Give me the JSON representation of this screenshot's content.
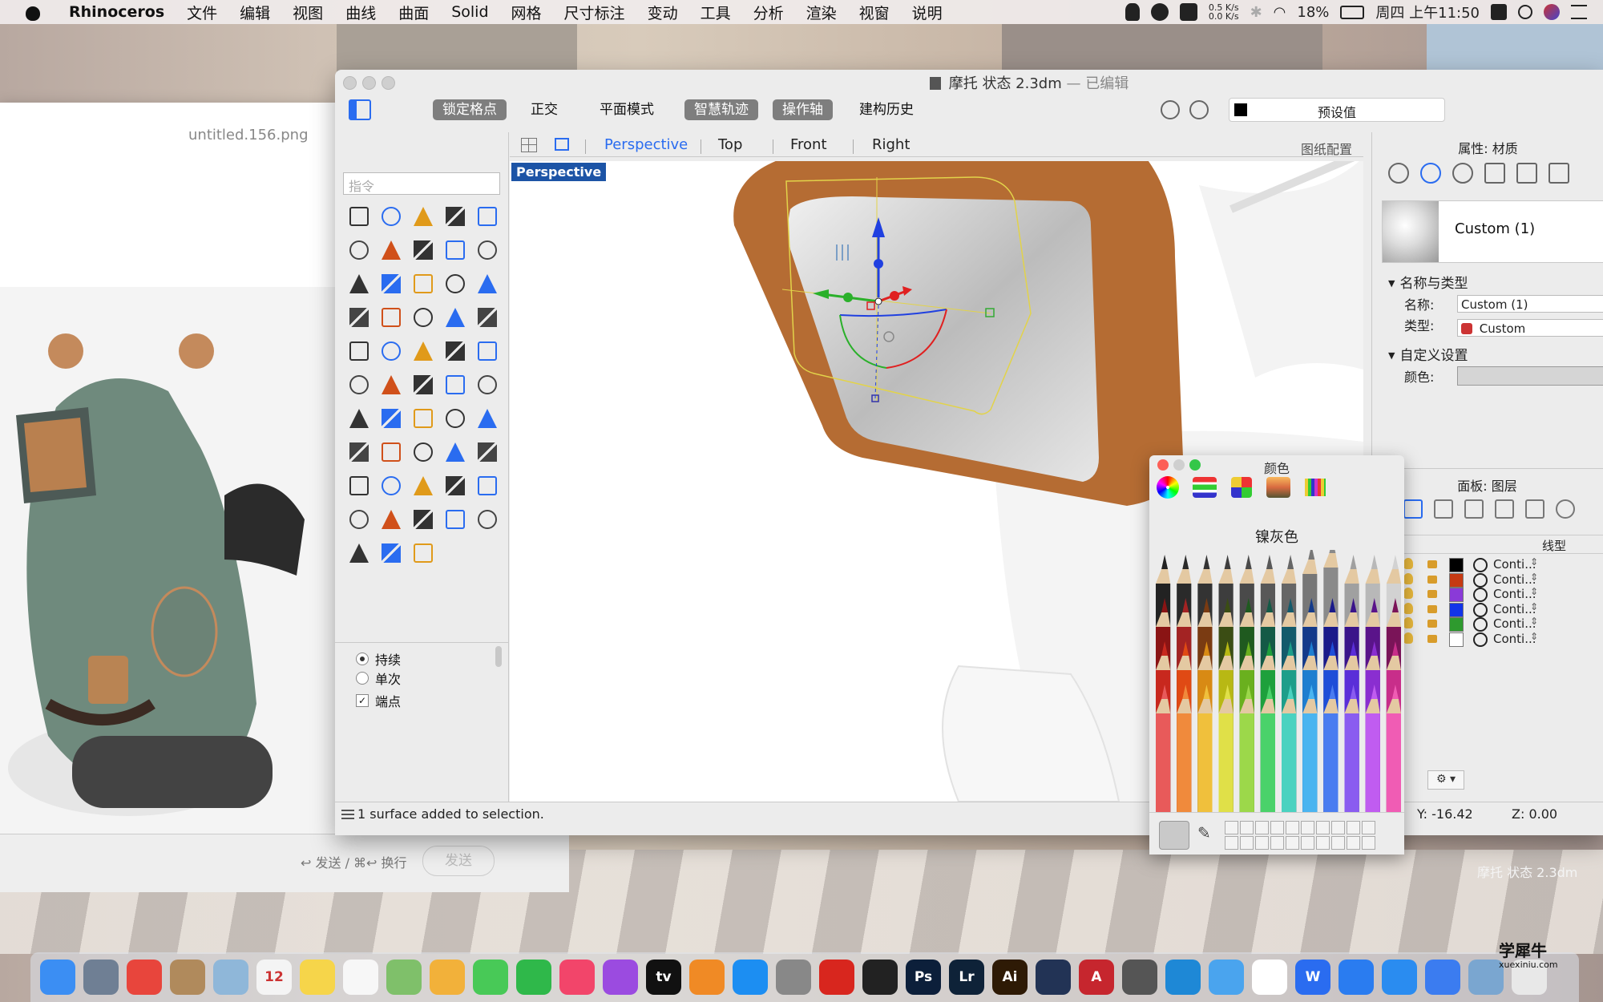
{
  "menubar": {
    "app_name": "Rhinoceros",
    "items": [
      "文件",
      "编辑",
      "视图",
      "曲线",
      "曲面",
      "Solid",
      "网格",
      "尺寸标注",
      "变动",
      "工具",
      "分析",
      "渲染",
      "视窗",
      "说明"
    ],
    "net_up": "0.5 K/s",
    "net_down": "0.0 K/s",
    "battery": "18%",
    "clock": "周四 上午11:50"
  },
  "preview_window": {
    "filename": "untitled.156.png"
  },
  "chat_window": {
    "hint": "↩ 发送 / ⌘↩ 换行",
    "send_label": "发送"
  },
  "rhino_window": {
    "title": "摩托 状态 2.3dm",
    "title_status": "— 已编辑",
    "toolbar": {
      "buttons": [
        {
          "label": "锁定格点",
          "on": true
        },
        {
          "label": "正交",
          "on": false
        },
        {
          "label": "平面模式",
          "on": false
        },
        {
          "label": "智慧轨迹",
          "on": true
        },
        {
          "label": "操作轴",
          "on": true
        },
        {
          "label": "建构历史",
          "on": false
        }
      ],
      "preset_label": "预设值",
      "preset_color": "#000000"
    },
    "command_placeholder": "指令",
    "command_options": {
      "persist_label": "持续",
      "once_label": "单次",
      "endpoint_label": "端点",
      "persist_selected": true,
      "endpoint_checked": true
    },
    "viewport_tabs": [
      "Perspective",
      "Top",
      "Front",
      "Right"
    ],
    "active_viewport": "Perspective",
    "layout_config_label": "图纸配置",
    "viewport_label": "Perspective",
    "status_text": "1 surface added to selection.",
    "coords": {
      "y": "Y: -16.42",
      "z": "Z: 0.00"
    }
  },
  "properties_panel": {
    "title": "属性: 材质",
    "material_name": "Custom (1)",
    "section_name_type": "名称与类型",
    "name_label": "名称:",
    "name_value": "Custom (1)",
    "type_label": "类型:",
    "type_value": "Custom",
    "section_custom": "自定义设置",
    "color_label": "颜色:"
  },
  "layers_panel": {
    "title": "面板: 图层",
    "column_linetype": "线型",
    "rows": [
      {
        "color": "#000000",
        "linetype": "Conti...",
        "current": true
      },
      {
        "color": "#c63a12",
        "linetype": "Conti...",
        "current": false
      },
      {
        "color": "#8a3ad8",
        "linetype": "Conti...",
        "current": false
      },
      {
        "color": "#1234e8",
        "linetype": "Conti...",
        "current": false
      },
      {
        "color": "#2e9a2e",
        "linetype": "Conti...",
        "current": false
      },
      {
        "color": "#ffffff",
        "linetype": "Conti...",
        "current": false
      }
    ],
    "minus_label": "—"
  },
  "color_picker": {
    "title": "颜色",
    "color_name": "镍灰色",
    "current_color": "#c9c9c9"
  },
  "background_caption": "摩托 状态 2.3dm",
  "watermark": {
    "line1": "学犀牛",
    "line2": "xuexiniu.com"
  },
  "dock": {
    "apps": [
      {
        "icon": "finder-icon",
        "color": "#3b8ef3",
        "glyph": ""
      },
      {
        "icon": "launchpad-icon",
        "color": "#6f7f94",
        "glyph": ""
      },
      {
        "icon": "chrome-icon",
        "color": "#e8453c",
        "glyph": ""
      },
      {
        "icon": "contacts-icon",
        "color": "#b08a5c",
        "glyph": ""
      },
      {
        "icon": "preview-icon",
        "color": "#8fb7d9",
        "glyph": ""
      },
      {
        "icon": "calendar-icon",
        "color": "#f4f4f4",
        "glyph": "12"
      },
      {
        "icon": "notes-icon",
        "color": "#f6d54a",
        "glyph": ""
      },
      {
        "icon": "reminders-icon",
        "color": "#f7f7f7",
        "glyph": ""
      },
      {
        "icon": "maps-icon",
        "color": "#7fc06a",
        "glyph": ""
      },
      {
        "icon": "photos-icon",
        "color": "#f2b13a",
        "glyph": ""
      },
      {
        "icon": "messages-icon",
        "color": "#48c957",
        "glyph": ""
      },
      {
        "icon": "facetime-icon",
        "color": "#2fb84a",
        "glyph": ""
      },
      {
        "icon": "music-icon",
        "color": "#f2456a",
        "glyph": ""
      },
      {
        "icon": "podcasts-icon",
        "color": "#9b4be0",
        "glyph": ""
      },
      {
        "icon": "apple-tv-icon",
        "color": "#111111",
        "glyph": "tv"
      },
      {
        "icon": "books-icon",
        "color": "#f08a25",
        "glyph": ""
      },
      {
        "icon": "app-store-icon",
        "color": "#1c8ef2",
        "glyph": ""
      },
      {
        "icon": "system-prefs-icon",
        "color": "#888888",
        "glyph": ""
      },
      {
        "icon": "netease-music-icon",
        "color": "#d8261e",
        "glyph": ""
      },
      {
        "icon": "qq-icon",
        "color": "#222222",
        "glyph": ""
      },
      {
        "icon": "photoshop-icon",
        "color": "#0c1f3a",
        "glyph": "Ps"
      },
      {
        "icon": "lightroom-icon",
        "color": "#0e2238",
        "glyph": "Lr"
      },
      {
        "icon": "illustrator-icon",
        "color": "#2e1a05",
        "glyph": "Ai"
      },
      {
        "icon": "cinema4d-icon",
        "color": "#223355",
        "glyph": ""
      },
      {
        "icon": "autocad-icon",
        "color": "#c6262e",
        "glyph": "A"
      },
      {
        "icon": "rhino-icon",
        "color": "#555555",
        "glyph": ""
      },
      {
        "icon": "keyshot-icon",
        "color": "#1e88d6",
        "glyph": ""
      },
      {
        "icon": "xcode-icon",
        "color": "#4aa4ee",
        "glyph": ""
      },
      {
        "icon": "baidu-netdisk-icon",
        "color": "#ffffff",
        "glyph": ""
      },
      {
        "icon": "wps-icon",
        "color": "#2a6cf0",
        "glyph": "W"
      },
      {
        "icon": "search-app-icon",
        "color": "#2a7cf0",
        "glyph": ""
      },
      {
        "icon": "safari-icon",
        "color": "#2a8cf0",
        "glyph": ""
      },
      {
        "icon": "feishu-icon",
        "color": "#3b7cf0",
        "glyph": ""
      },
      {
        "icon": "preview-files-icon",
        "color": "#7aa6d0",
        "glyph": ""
      },
      {
        "icon": "trash-icon",
        "color": "#e8e8e8",
        "glyph": ""
      }
    ]
  }
}
